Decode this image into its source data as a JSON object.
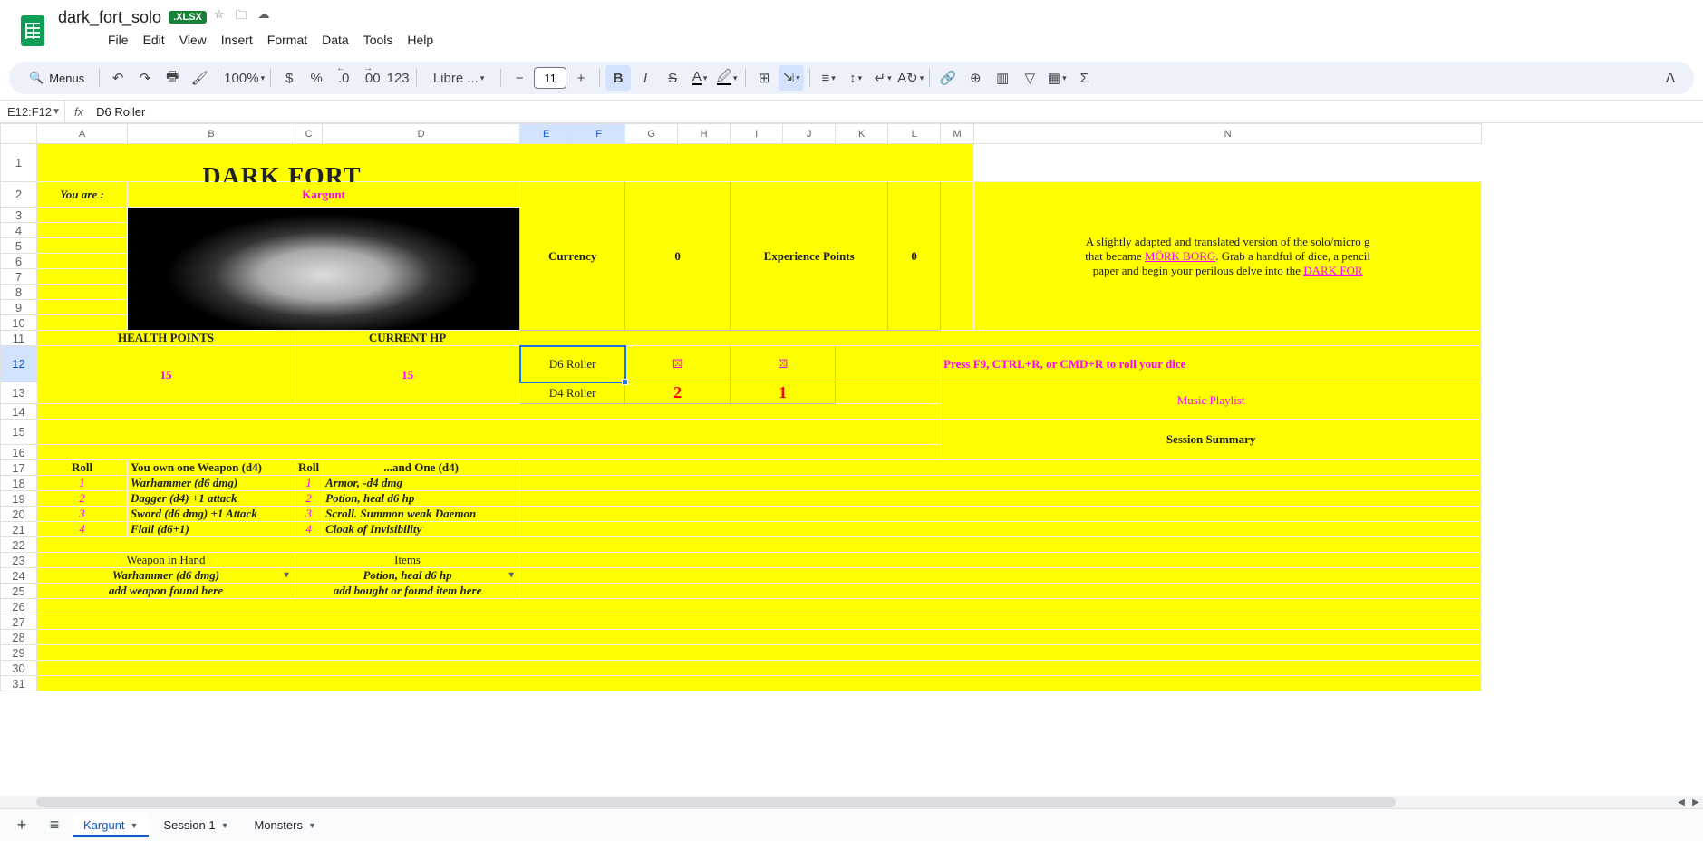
{
  "doc": {
    "title": "dark_fort_solo",
    "badge": ".XLSX"
  },
  "menu": [
    "File",
    "Edit",
    "View",
    "Insert",
    "Format",
    "Data",
    "Tools",
    "Help"
  ],
  "toolbar": {
    "search_label": "Menus",
    "zoom": "100%",
    "font": "Libre ...",
    "font_size": "11",
    "decimals_dec": ".0",
    "decimals_inc": ".00",
    "format_123": "123"
  },
  "namebox": "E12:F12",
  "fx_label": "fx",
  "formula": "D6 Roller",
  "cols": [
    "A",
    "B",
    "C",
    "D",
    "E",
    "F",
    "G",
    "H",
    "I",
    "J",
    "K",
    "L",
    "M",
    "N"
  ],
  "cells": {
    "title": "DARK FORT",
    "you_are": "You are :",
    "player": "Kargunt",
    "currency_lbl": "Currency",
    "currency_val": "0",
    "xp_lbl": "Experience Points",
    "xp_val": "0",
    "hp_hdr": "HEALTH POINTS",
    "cur_hp_hdr": "CURRENT HP",
    "hp_val": "15",
    "cur_hp_val": "15",
    "d6_label": "D6 Roller",
    "d4_label": "D4 Roller",
    "d6_dice1": "⚄",
    "d6_dice2": "⚄",
    "d4_val1": "2",
    "d4_val2": "1",
    "roll_instr": "Press F9, CTRL+R, or CMD+R to roll your dice",
    "playlist": "Music Playlist",
    "session": "Session Summary",
    "intro_pre": "A slightly adapted and translated version of the solo/micro g",
    "intro_mid1": "that became ",
    "intro_link1": "MÖRK BORG",
    "intro_mid2": ". Grab a handful of dice, a pencil",
    "intro_post1": "paper and begin your perilous delve into the ",
    "intro_link2": "DARK FOR",
    "tbl": {
      "roll_hdr": "Roll",
      "weap_hdr": "You own one Weapon (d4)",
      "item_hdr": "...and One (d4)",
      "rows": [
        {
          "n": "1",
          "w": "Warhammer (d6 dmg)",
          "i": "Armor, -d4 dmg"
        },
        {
          "n": "2",
          "w": "Dagger (d4) +1 attack",
          "i": "Potion, heal d6 hp"
        },
        {
          "n": "3",
          "w": "Sword (d6 dmg) +1 Attack",
          "i": "Scroll. Summon weak Daemon"
        },
        {
          "n": "4",
          "w": "Flail (d6+1)",
          "i": "Cloak of Invisibility"
        }
      ],
      "weapon_in_hand_hdr": "Weapon in Hand",
      "items_hdr": "Items",
      "weapon_sel": "Warhammer (d6 dmg)",
      "item_sel": "Potion, heal d6 hp",
      "weapon_add": "add weapon found here",
      "item_add": "add bought or found item here"
    }
  },
  "tabs": {
    "items": [
      "Kargunt",
      "Session 1",
      "Monsters"
    ],
    "active": 0
  }
}
